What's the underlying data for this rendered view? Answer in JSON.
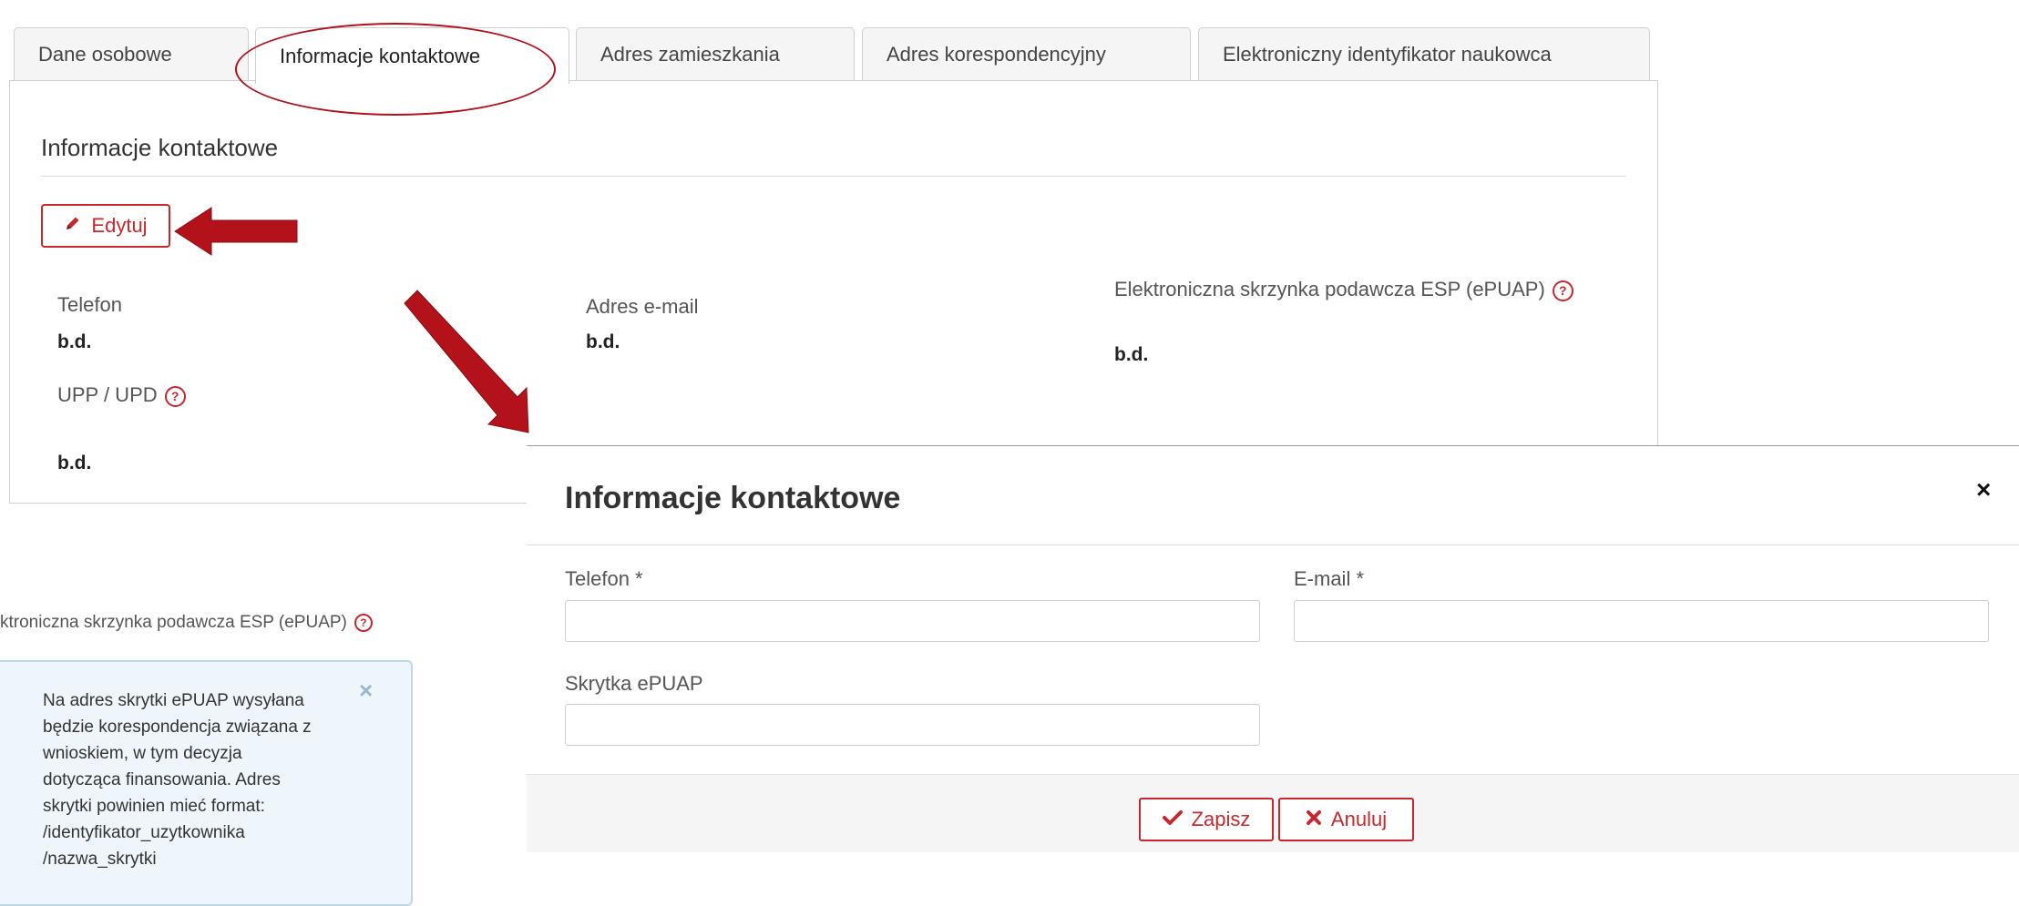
{
  "tabs": [
    {
      "label": "Dane osobowe",
      "active": false
    },
    {
      "label": "Informacje kontaktowe",
      "active": true
    },
    {
      "label": "Adres zamieszkania",
      "active": false
    },
    {
      "label": "Adres korespondencyjny",
      "active": false
    },
    {
      "label": "Elektroniczny identyfikator naukowca",
      "active": false
    }
  ],
  "section": {
    "title": "Informacje kontaktowe",
    "edit_label": "Edytuj",
    "fields": {
      "phone_label": "Telefon",
      "phone_value": "b.d.",
      "upp_label": "UPP / UPD",
      "upp_value": "b.d.",
      "email_label": "Adres e-mail",
      "email_value": "b.d.",
      "esp_label": "Elektroniczna skrzynka podawcza ESP (ePUAP)",
      "esp_value": "b.d."
    }
  },
  "modal": {
    "title": "Informacje kontaktowe",
    "close": "×",
    "phone_label": "Telefon *",
    "email_label": "E-mail *",
    "epuap_label": "Skrytka ePUAP",
    "phone_value": "",
    "email_value": "",
    "epuap_value": "",
    "save_label": "Zapisz",
    "cancel_label": "Anuluj"
  },
  "popover": {
    "label": "ktroniczna skrzynka podawcza ESP (ePUAP)",
    "text": "Na adres skrytki ePUAP wysyłana\nbędzie korespondencja związana z\nwnioskiem, w tym decyzja\ndotycząca finansowania. Adres\nskrytki powinien mieć format:\n/identyfikator_uzytkownika\n/nazwa_skrytki",
    "close": "×"
  },
  "colors": {
    "accent": "#c9272e",
    "annotation": "#b3121b",
    "popover_bg": "#eef6fb"
  }
}
